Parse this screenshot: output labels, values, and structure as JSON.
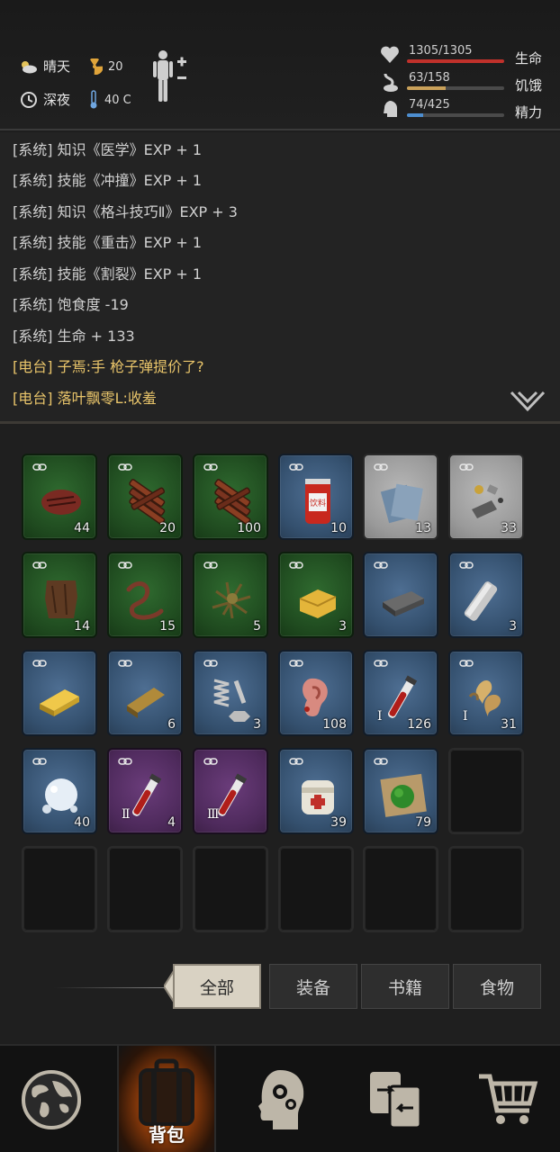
{
  "status": {
    "weather": "晴天",
    "radiation": "20",
    "time_of_day": "深夜",
    "temperature": "40 C",
    "vitals": [
      {
        "value": "1305/1305",
        "label": "生命",
        "fill": 1.0,
        "color": "#c0312b"
      },
      {
        "value": "63/158",
        "label": "饥饿",
        "fill": 0.4,
        "color": "#c9a15a"
      },
      {
        "value": "74/425",
        "label": "精力",
        "fill": 0.17,
        "color": "#4d8ed0"
      }
    ]
  },
  "log": [
    {
      "tag": "[系统]",
      "msg": "知识《医学》EXP + 1",
      "type": "system"
    },
    {
      "tag": "[系统]",
      "msg": "技能《冲撞》EXP + 1",
      "type": "system"
    },
    {
      "tag": "[系统]",
      "msg": "知识《格斗技巧Ⅱ》EXP + 3",
      "type": "system"
    },
    {
      "tag": "[系统]",
      "msg": "技能《重击》EXP + 1",
      "type": "system"
    },
    {
      "tag": "[系统]",
      "msg": "技能《割裂》EXP + 1",
      "type": "system"
    },
    {
      "tag": "[系统]",
      "msg": "饱食度 -19",
      "type": "system"
    },
    {
      "tag": "[系统]",
      "msg": "生命 + 133",
      "type": "system"
    },
    {
      "tag": "[电台]",
      "msg": "子焉:手 枪子弹提价了?",
      "type": "radio"
    },
    {
      "tag": "[电台]",
      "msg": "落叶飘零L:收羞",
      "type": "radio"
    }
  ],
  "inventory": [
    {
      "icon": "steak-icon",
      "rarity": "green",
      "count": "44"
    },
    {
      "icon": "jerky-icon",
      "rarity": "green",
      "count": "20"
    },
    {
      "icon": "jerky-icon",
      "rarity": "green",
      "count": "100"
    },
    {
      "icon": "drink-can-icon",
      "rarity": "blue",
      "count": "10",
      "label": "饮料"
    },
    {
      "icon": "paper-sheets-icon",
      "rarity": "gray",
      "count": "13"
    },
    {
      "icon": "scrap-metal-icon",
      "rarity": "gray",
      "count": "33"
    },
    {
      "icon": "leather-hide-icon",
      "rarity": "green",
      "count": "14"
    },
    {
      "icon": "worm-icon",
      "rarity": "green",
      "count": "15"
    },
    {
      "icon": "twigs-icon",
      "rarity": "green",
      "count": "5"
    },
    {
      "icon": "butter-block-icon",
      "rarity": "green",
      "count": "3"
    },
    {
      "icon": "iron-ingot-icon",
      "rarity": "blue",
      "count": ""
    },
    {
      "icon": "steel-bar-icon",
      "rarity": "blue",
      "count": "3"
    },
    {
      "icon": "gold-bar-icon",
      "rarity": "blue",
      "count": ""
    },
    {
      "icon": "bronze-bar-icon",
      "rarity": "blue",
      "count": "6"
    },
    {
      "icon": "spring-bolt-icon",
      "rarity": "blue",
      "count": "3"
    },
    {
      "icon": "ear-icon",
      "rarity": "blue",
      "count": "108"
    },
    {
      "icon": "blood-vial-icon",
      "rarity": "blue",
      "count": "126",
      "tier": "Ⅰ"
    },
    {
      "icon": "claw-icon",
      "rarity": "blue",
      "count": "31",
      "tier": "Ⅰ"
    },
    {
      "icon": "snowball-icon",
      "rarity": "blue",
      "count": "40"
    },
    {
      "icon": "blood-vial-icon",
      "rarity": "purple",
      "count": "4",
      "tier": "Ⅱ"
    },
    {
      "icon": "blood-vial-icon",
      "rarity": "purple",
      "count": "",
      "tier": "Ⅲ"
    },
    {
      "icon": "bandage-icon",
      "rarity": "blue",
      "count": "39"
    },
    {
      "icon": "herb-poultice-icon",
      "rarity": "blue",
      "count": "79"
    },
    {
      "icon": "",
      "rarity": "empty",
      "count": ""
    },
    {
      "icon": "",
      "rarity": "empty",
      "count": ""
    },
    {
      "icon": "",
      "rarity": "empty",
      "count": ""
    },
    {
      "icon": "",
      "rarity": "empty",
      "count": ""
    },
    {
      "icon": "",
      "rarity": "empty",
      "count": ""
    },
    {
      "icon": "",
      "rarity": "empty",
      "count": ""
    },
    {
      "icon": "",
      "rarity": "empty",
      "count": ""
    }
  ],
  "filter_tabs": [
    {
      "label": "全部",
      "active": true
    },
    {
      "label": "装备",
      "active": false
    },
    {
      "label": "书籍",
      "active": false
    },
    {
      "label": "食物",
      "active": false
    }
  ],
  "nav": [
    {
      "icon": "world-map-icon",
      "label": ""
    },
    {
      "icon": "backpack-icon",
      "label": "背包",
      "active": true
    },
    {
      "icon": "head-gears-icon",
      "label": ""
    },
    {
      "icon": "trade-swap-icon",
      "label": ""
    },
    {
      "icon": "cart-icon",
      "label": ""
    }
  ]
}
